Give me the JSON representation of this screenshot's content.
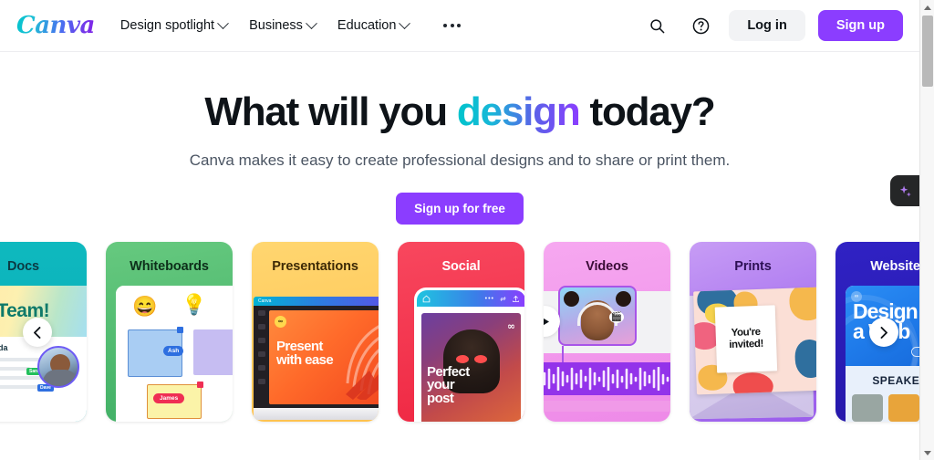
{
  "header": {
    "logo_text": "Canva",
    "nav_items": [
      {
        "label": "Design spotlight",
        "has_chevron": true
      },
      {
        "label": "Business",
        "has_chevron": true
      },
      {
        "label": "Education",
        "has_chevron": true
      }
    ],
    "more_label": "More",
    "search_label": "Search",
    "help_label": "Help",
    "login_label": "Log in",
    "signup_label": "Sign up"
  },
  "hero": {
    "headline_part1": "What will you ",
    "headline_highlight": "design",
    "headline_part2": " today?",
    "subheadline": "Canva makes it easy to create professional designs and to share or print them.",
    "cta_label": "Sign up for free"
  },
  "magic_button": {
    "label": "Magic Studio"
  },
  "carousel": {
    "prev_label": "Previous",
    "next_label": "Next",
    "cards": [
      {
        "title": "Docs",
        "accent": "#0eb9bf",
        "art_text": "Hi Team!",
        "author": "Amanda"
      },
      {
        "title": "Whiteboards",
        "accent": "#4cb96c",
        "collaborator1": "Ash",
        "collaborator2": "James"
      },
      {
        "title": "Presentations",
        "accent": "#ffc94d",
        "slide_line1": "Present",
        "slide_line2": "with ease",
        "app_name": "Canva"
      },
      {
        "title": "Social",
        "accent": "#f43b54",
        "post_line1": "Perfect",
        "post_line2": "your",
        "post_line3": "post"
      },
      {
        "title": "Videos",
        "accent": "#ef8ae8"
      },
      {
        "title": "Prints",
        "accent": "#a974ef",
        "invite_line1": "You're",
        "invite_line2": "invited!"
      },
      {
        "title": "Websites",
        "accent": "#2a1cb8",
        "web_line1": "Design",
        "web_line2": "a Web",
        "web_section": "SPEAKERS"
      }
    ]
  },
  "colors": {
    "brand_purple": "#8b3dff",
    "brand_cyan": "#00c4cc",
    "text_dark": "#0e1318",
    "text_muted": "#4b5563"
  }
}
